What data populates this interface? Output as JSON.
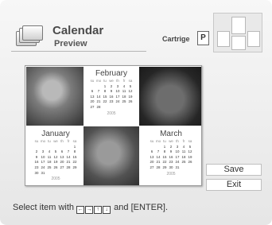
{
  "header": {
    "title": "Calendar",
    "subtitle": "Preview",
    "icon": "calendar-stack-icon",
    "cartridge_label": "Cartrige",
    "cartridge_value": "P"
  },
  "layout_thumbnail": {
    "icon": "layout-thumbnail-icon"
  },
  "preview": {
    "photos": [
      "cat-photo",
      "shiba-photo",
      "dog-photo"
    ],
    "calendars": {
      "february": {
        "name": "February",
        "year": "2005",
        "dow": [
          "su",
          "mo",
          "tu",
          "we",
          "th",
          "fr",
          "sa"
        ],
        "rows": [
          [
            "",
            "",
            "1",
            "2",
            "3",
            "4",
            "5"
          ],
          [
            "6",
            "7",
            "8",
            "9",
            "10",
            "11",
            "12"
          ],
          [
            "13",
            "14",
            "15",
            "16",
            "17",
            "18",
            "19"
          ],
          [
            "20",
            "21",
            "22",
            "23",
            "24",
            "25",
            "26"
          ],
          [
            "27",
            "28",
            "",
            "",
            "",
            "",
            ""
          ]
        ]
      },
      "january": {
        "name": "January",
        "year": "2005",
        "dow": [
          "su",
          "mo",
          "tu",
          "we",
          "th",
          "fr",
          "sa"
        ],
        "rows": [
          [
            "",
            "",
            "",
            "",
            "",
            "",
            "1"
          ],
          [
            "2",
            "3",
            "4",
            "5",
            "6",
            "7",
            "8"
          ],
          [
            "9",
            "10",
            "11",
            "12",
            "13",
            "14",
            "15"
          ],
          [
            "16",
            "17",
            "18",
            "19",
            "20",
            "21",
            "22"
          ],
          [
            "23",
            "24",
            "25",
            "26",
            "27",
            "28",
            "29"
          ],
          [
            "30",
            "31",
            "",
            "",
            "",
            "",
            ""
          ]
        ]
      },
      "march": {
        "name": "March",
        "year": "2005",
        "dow": [
          "su",
          "mo",
          "tu",
          "we",
          "th",
          "fr",
          "sa"
        ],
        "rows": [
          [
            "",
            "",
            "1",
            "2",
            "3",
            "4",
            "5"
          ],
          [
            "6",
            "7",
            "8",
            "9",
            "10",
            "11",
            "12"
          ],
          [
            "13",
            "14",
            "15",
            "16",
            "17",
            "18",
            "19"
          ],
          [
            "20",
            "21",
            "22",
            "23",
            "24",
            "25",
            "26"
          ],
          [
            "27",
            "28",
            "29",
            "30",
            "31",
            "",
            ""
          ]
        ]
      }
    }
  },
  "buttons": {
    "save": "Save",
    "exit": "Exit"
  },
  "instruction": {
    "prefix": "Select item with",
    "keys": [
      "←",
      "→",
      "↑",
      "↓"
    ],
    "suffix": "and [ENTER]."
  }
}
